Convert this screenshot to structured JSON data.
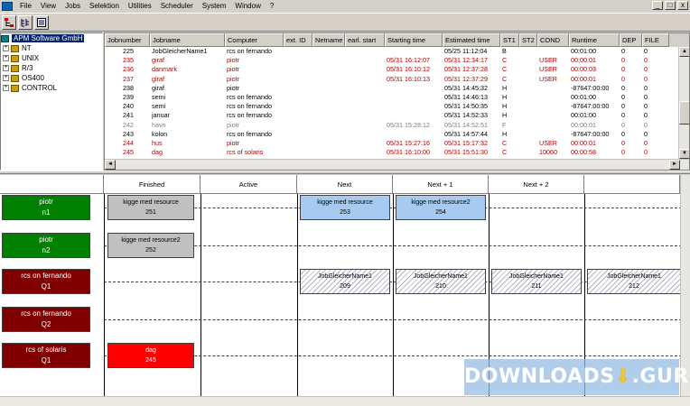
{
  "menu": [
    "File",
    "View",
    "Jobs",
    "Selektion",
    "Utilities",
    "Scheduler",
    "System",
    "Window",
    "?"
  ],
  "window_controls": [
    "_",
    "□",
    "x"
  ],
  "toolbar": {
    "buttons": [
      {
        "icon": "hierarchy-icon"
      },
      {
        "icon": "tree-view-icon"
      },
      {
        "icon": "list-view-icon"
      }
    ]
  },
  "tree": {
    "root": "APM Software GmbH",
    "nodes": [
      "NT",
      "UNIX",
      "R/3",
      "OS400",
      "CONTROL"
    ]
  },
  "grid": {
    "columns": [
      "Jobnumber",
      "Jobname",
      "Computer",
      "ext. ID",
      "Netname",
      "earl. start",
      "Starting time",
      "Estimated time",
      "ST1",
      "ST2",
      "COND",
      "Runtime",
      "DEP",
      "FILE"
    ],
    "rows": [
      {
        "style": "",
        "cells": [
          "225",
          "JobGleicherName1",
          "rcs on fernando",
          "",
          "",
          "",
          "",
          "05/25 11:12:04",
          "B",
          "",
          "",
          "00:01:00",
          "0",
          "0"
        ]
      },
      {
        "style": "red",
        "cells": [
          "235",
          "giraf",
          "piotr",
          "",
          "",
          "",
          "05/31 16:12:07",
          "05/31 12:34:17",
          "C",
          "",
          "USER",
          "00:00:01",
          "0",
          "0"
        ]
      },
      {
        "style": "red",
        "cells": [
          "236",
          "danmark",
          "piotr",
          "",
          "",
          "",
          "05/31 16:10:12",
          "05/31 12:37:28",
          "C",
          "",
          "USER",
          "00:00:03",
          "0",
          "0"
        ]
      },
      {
        "style": "red",
        "cells": [
          "237",
          "giraf",
          "piotr",
          "",
          "",
          "",
          "05/31 16:10:13",
          "05/31 12:37:29",
          "C",
          "",
          "USER",
          "00:00:01",
          "0",
          "0"
        ]
      },
      {
        "style": "",
        "cells": [
          "238",
          "giraf",
          "piotr",
          "",
          "",
          "",
          "",
          "05/31 14:45:32",
          "H",
          "",
          "",
          "-87647:00:00",
          "0",
          "0"
        ]
      },
      {
        "style": "",
        "cells": [
          "239",
          "semi",
          "rcs on fernando",
          "",
          "",
          "",
          "",
          "05/31 14:46:13",
          "H",
          "",
          "",
          "00:01:00",
          "0",
          "0"
        ]
      },
      {
        "style": "",
        "cells": [
          "240",
          "semi",
          "rcs on fernando",
          "",
          "",
          "",
          "",
          "05/31 14:50:35",
          "H",
          "",
          "",
          "-87647:00:00",
          "0",
          "0"
        ]
      },
      {
        "style": "",
        "cells": [
          "241",
          "januar",
          "rcs on fernando",
          "",
          "",
          "",
          "",
          "05/31 14:52:33",
          "H",
          "",
          "",
          "00:01:00",
          "0",
          "0"
        ]
      },
      {
        "style": "gray",
        "cells": [
          "242",
          "havn",
          "piotr",
          "",
          "",
          "",
          "05/31 15:28:12",
          "05/31 14:52:51",
          "F",
          "",
          "",
          "00:00:01",
          "0",
          "0"
        ]
      },
      {
        "style": "",
        "cells": [
          "243",
          "kolon",
          "rcs on fernando",
          "",
          "",
          "",
          "",
          "05/31 14:57:44",
          "H",
          "",
          "",
          "-87647:00:00",
          "0",
          "0"
        ]
      },
      {
        "style": "red",
        "cells": [
          "244",
          "hus",
          "piotr",
          "",
          "",
          "",
          "05/31 15:27:16",
          "05/31 15:17:32",
          "C",
          "",
          "USER",
          "00:00:01",
          "0",
          "0"
        ]
      },
      {
        "style": "red",
        "cells": [
          "245",
          "dag",
          "rcs of solaris",
          "",
          "",
          "",
          "05/31 16:10:00",
          "05/31 15:51:30",
          "C",
          "",
          "10060",
          "00:00:58",
          "0",
          "0"
        ]
      }
    ]
  },
  "schedule": {
    "columns": [
      "Finished",
      "Active",
      "Next",
      "Next + 1",
      "Next + 2"
    ],
    "queues": [
      {
        "host": "piotr",
        "queue": "n1",
        "color": "#008000"
      },
      {
        "host": "piotr",
        "queue": "n2",
        "color": "#008000"
      },
      {
        "host": "rcs on fernando",
        "queue": "Q1",
        "color": "#800000"
      },
      {
        "host": "rcs on fernando",
        "queue": "Q2",
        "color": "#800000"
      },
      {
        "host": "rcs of solaris",
        "queue": "Q1",
        "color": "#800000"
      }
    ],
    "jobs": [
      {
        "name": "kigge med resource",
        "number": "251",
        "style": "gray"
      },
      {
        "name": "kigge med resource",
        "number": "253",
        "style": "blue"
      },
      {
        "name": "kigge med resource2",
        "number": "254",
        "style": "blue"
      },
      {
        "name": "kigge med resource2",
        "number": "252",
        "style": "gray"
      },
      {
        "name": "JobGleicherName1",
        "number": "209",
        "style": "hatch"
      },
      {
        "name": "JobGleicherName1",
        "number": "210",
        "style": "hatch"
      },
      {
        "name": "JobGleicherName1",
        "number": "211",
        "style": "hatch"
      },
      {
        "name": "JobGleicherName1",
        "number": "212",
        "style": "hatch"
      },
      {
        "name": "dag",
        "number": "245",
        "style": "red"
      }
    ]
  },
  "watermark": {
    "text_left": "DOWNLOADS",
    "text_right": ".GURU"
  }
}
